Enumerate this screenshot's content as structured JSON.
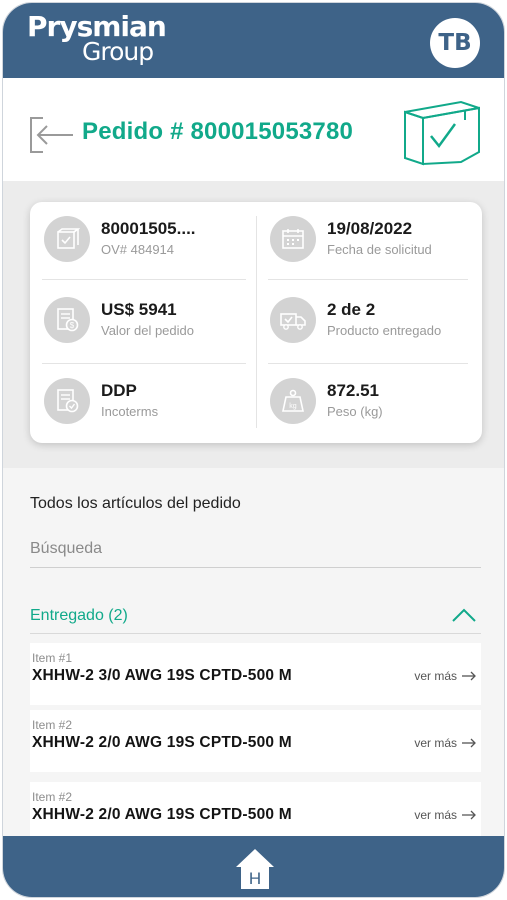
{
  "header": {
    "logo_line1": "Prysmian",
    "logo_line2": "Group",
    "avatar_initials": "TB"
  },
  "order": {
    "title": "Pedido # 800015053780"
  },
  "summary": [
    {
      "value": "80001505....",
      "label": "OV# 484914",
      "icon": "box-check-icon"
    },
    {
      "value": "19/08/2022",
      "label": "Fecha de solicitud",
      "icon": "calendar-icon"
    },
    {
      "value": "US$ 5941",
      "label": "Valor del pedido",
      "icon": "invoice-dollar-icon"
    },
    {
      "value": "2 de 2",
      "label": "Producto entregado",
      "icon": "truck-check-icon"
    },
    {
      "value": "DDP",
      "label": "Incoterms",
      "icon": "certificate-icon"
    },
    {
      "value": "872.51",
      "label": "Peso (kg)",
      "icon": "weight-kg-icon"
    }
  ],
  "items_section": {
    "title": "Todos los artículos del pedido",
    "search_placeholder": "Búsqueda",
    "group_title": "Entregado (2)",
    "items": [
      {
        "number": "Item #1",
        "name": "XHHW-2 3/0 AWG 19S CPTD-500 M",
        "more": "ver más"
      },
      {
        "number": "Item #2",
        "name": "XHHW-2 2/0 AWG 19S CPTD-500 M",
        "more": "ver más"
      },
      {
        "number": "Item #2",
        "name": "XHHW-2 2/0 AWG 19S CPTD-500 M",
        "more": "ver más"
      }
    ]
  },
  "bottom_nav": {
    "home_letter": "H"
  },
  "colors": {
    "brand_blue": "#3e6388",
    "accent_green": "#11a98a"
  }
}
